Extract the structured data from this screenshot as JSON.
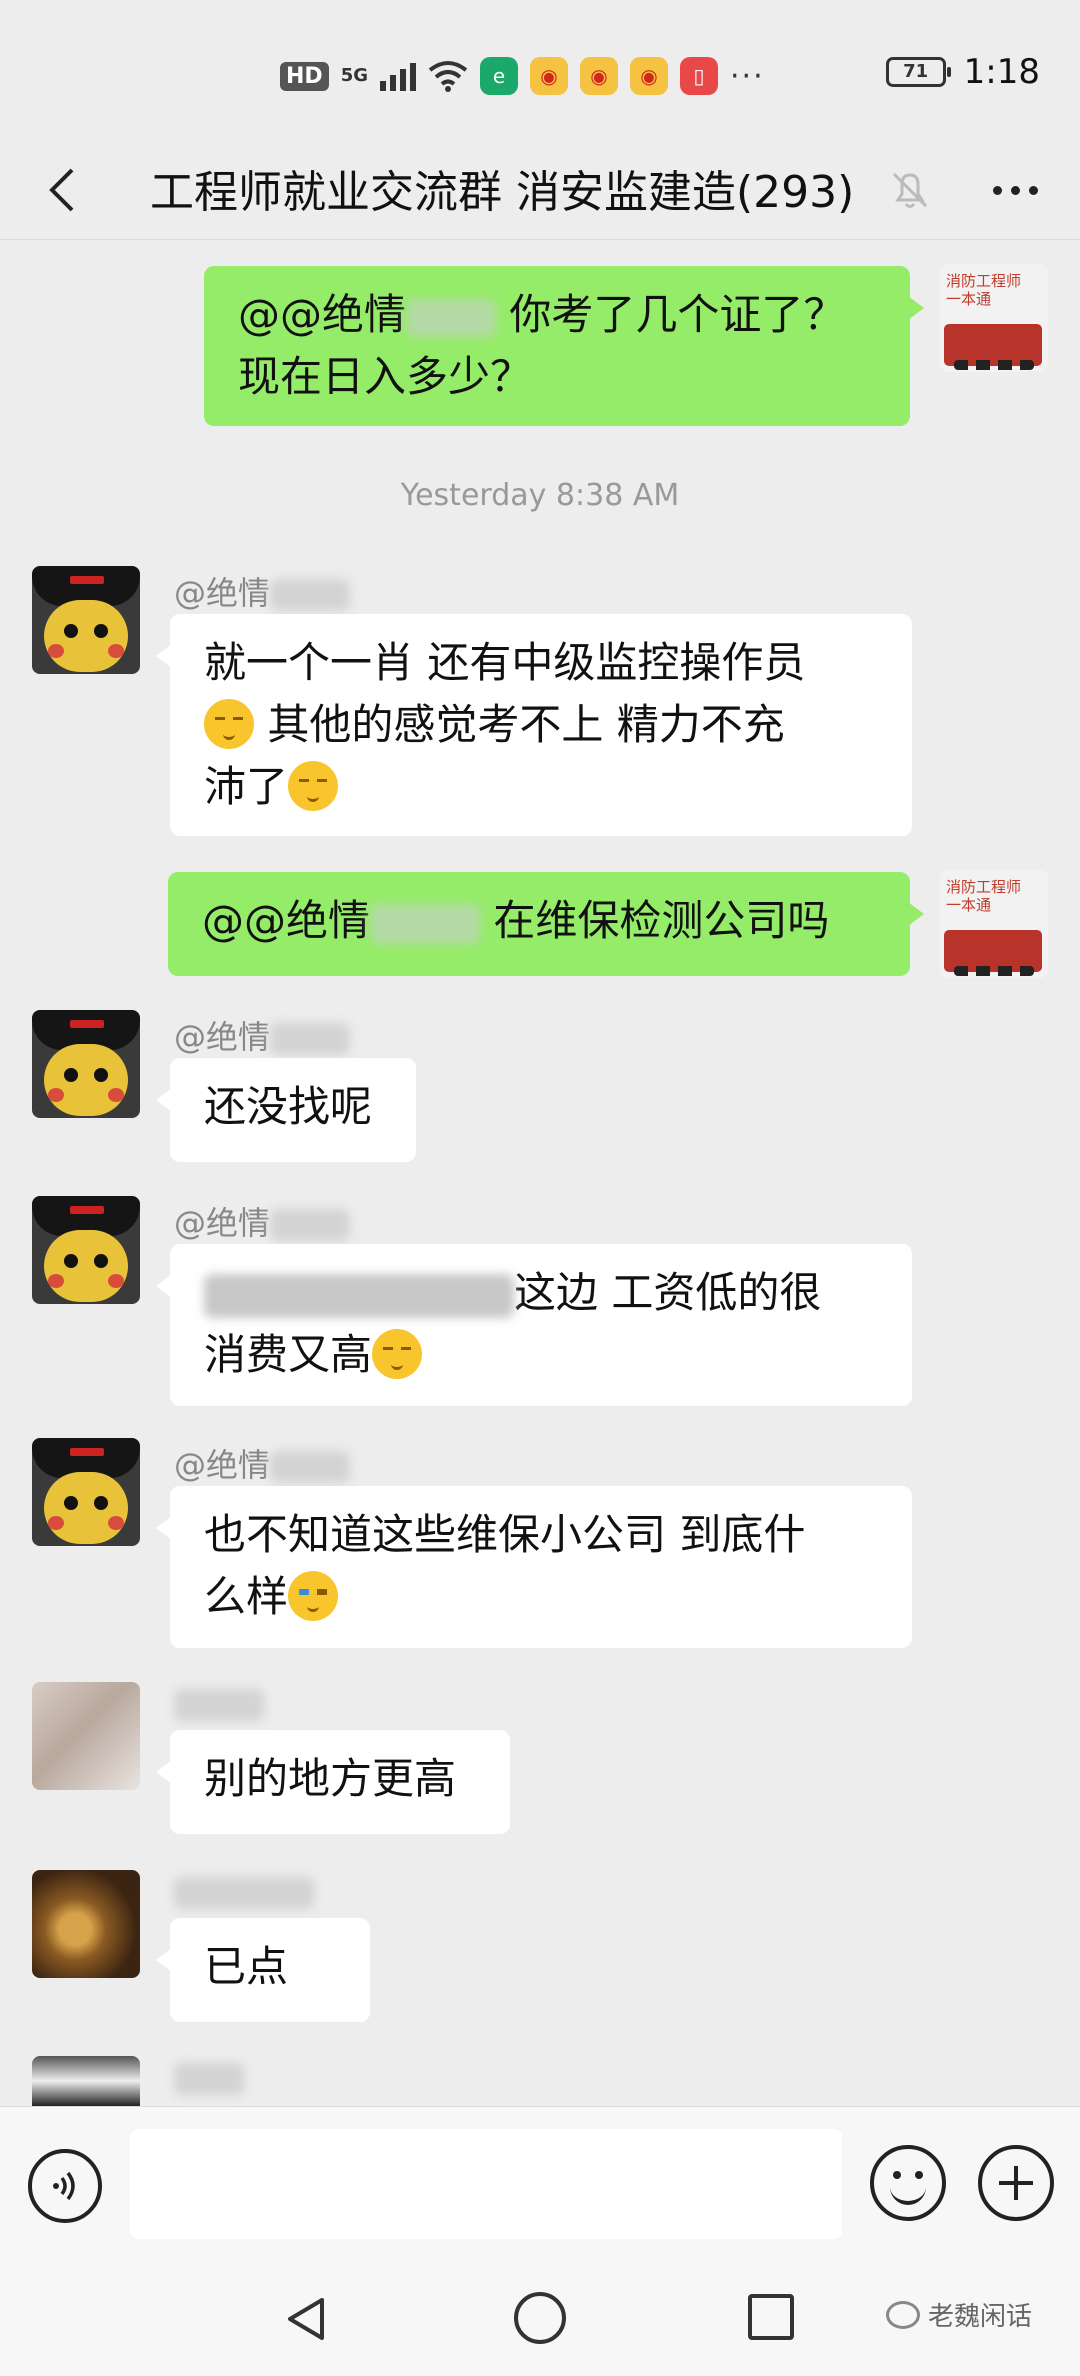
{
  "status_bar": {
    "hd": "HD",
    "network": "5G",
    "battery": "71",
    "time": "1:18",
    "more": "···"
  },
  "header": {
    "title": "工程师就业交流群 消安监建造(293)"
  },
  "timestamp": "Yesterday 8:38 AM",
  "messages": {
    "m1": {
      "line1_prefix": "@@绝情",
      "line1_suffix": " 你考了几个证了？",
      "line2": "现在日入多少？"
    },
    "m2": {
      "sender": "@绝情",
      "line1": "就一个一肖  还有中级监控操作员",
      "line2": "  其他的感觉考不上  精力不充",
      "line3": "沛了"
    },
    "m3": {
      "prefix": "@@绝情",
      "suffix": "   在维保检测公司吗"
    },
    "m4": {
      "sender": "@绝情",
      "text": "还没找呢"
    },
    "m5": {
      "sender": "@绝情",
      "line1": "这边  工资低的很",
      "line2": "消费又高"
    },
    "m6": {
      "sender": "@绝情",
      "line1": "也不知道这些维保小公司   到底什",
      "line2": "么样"
    },
    "m7": {
      "text": "别的地方更高"
    },
    "m8": {
      "text": "已点"
    }
  },
  "self_avatar": {
    "caption": "消防工程师\n一本通"
  },
  "watermark": "老魏闲话"
}
